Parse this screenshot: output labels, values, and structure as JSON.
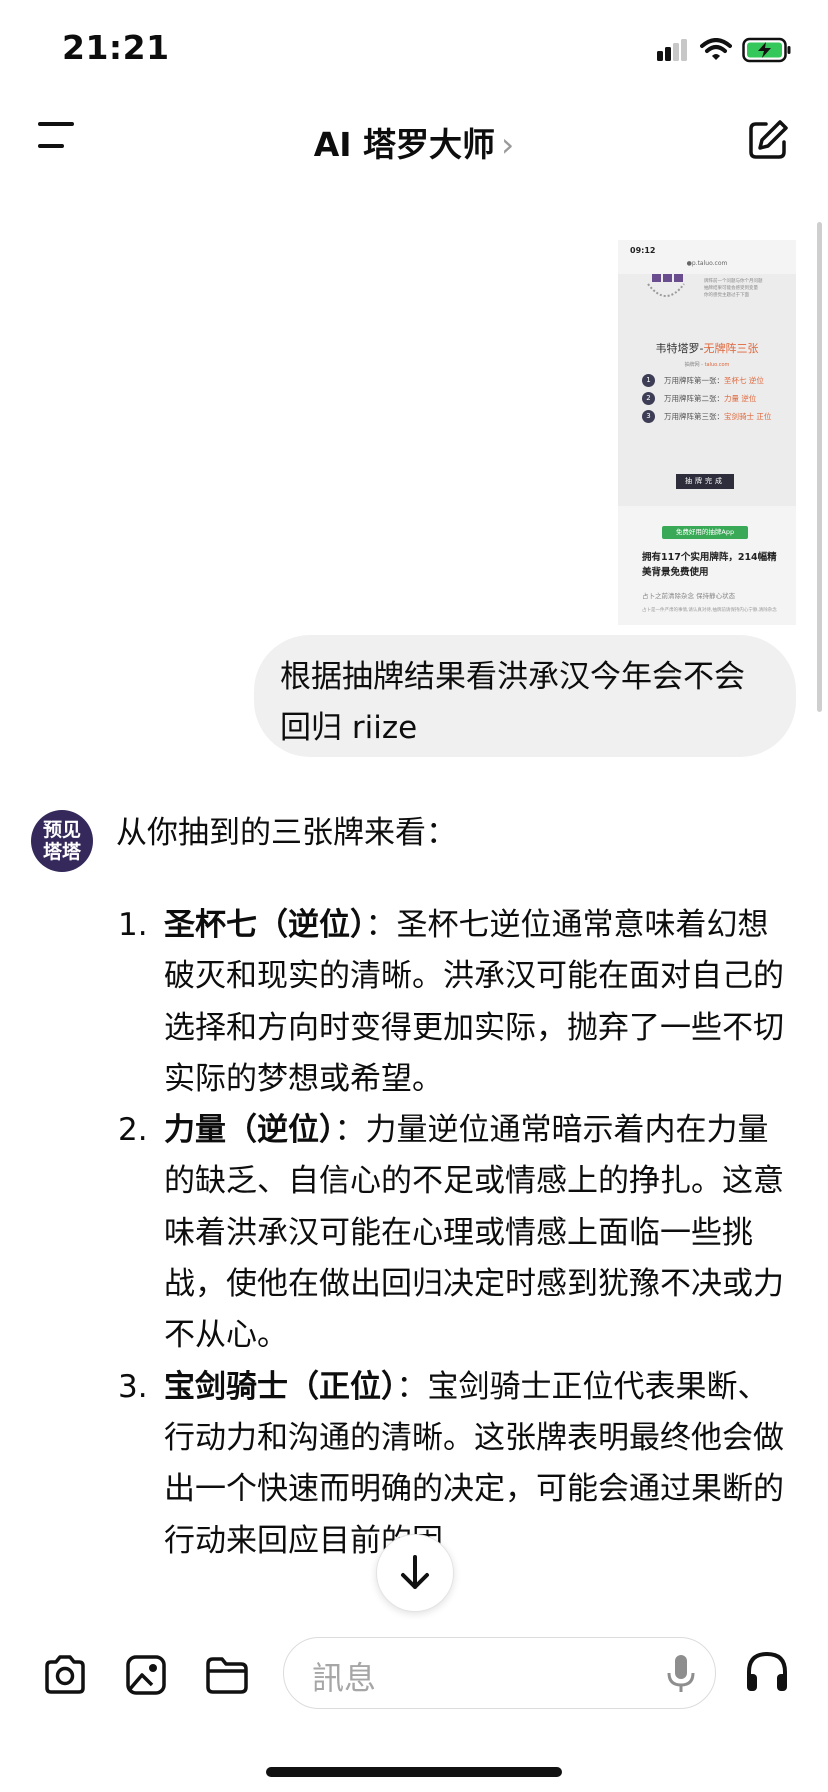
{
  "status_bar": {
    "time": "21:21",
    "icons": [
      "cellular-signal-icon",
      "wifi-icon",
      "battery-charging-icon"
    ]
  },
  "header": {
    "title": "AI 塔罗大师",
    "chevron": "›",
    "menu_icon": "menu-icon",
    "edit_icon": "new-chat-icon"
  },
  "attachment": {
    "status_time": "09:12",
    "url": "●p.taluo.com",
    "notice_lines": [
      "牌阵前一个问题与你个月问题",
      "抽牌结果可能会感受到变量",
      "你的感觉主题过于下面"
    ],
    "title_prefix": "韦特塔罗-",
    "title_highlight": "无牌阵三张",
    "source_prefix": "抽牌网 - ",
    "source_highlight": "taluo.com",
    "cards": [
      {
        "num": "1",
        "text": "万用牌阵第一张：",
        "result": "圣杯七 逆位"
      },
      {
        "num": "2",
        "text": "万用牌阵第二张：",
        "result": "力量 逆位"
      },
      {
        "num": "3",
        "text": "万用牌阵第三张：",
        "result": "宝剑骑士 正位"
      }
    ],
    "done_button": "抽牌完成",
    "app_button": "免费好用的抽牌App",
    "promo": "拥有117个实用牌阵，214幅精美背景免费使用",
    "tip": "占卜之前清除杂念 保持静心状态",
    "tiny": "占卜是一件严肃的事情,请认真对待,抽牌前请保持内心宁静,清除杂念"
  },
  "user_message": {
    "text": "根据抽牌结果看洪承汉今年会不会回归 riize"
  },
  "assistant": {
    "avatar_line1": "预见",
    "avatar_line2": "塔塔",
    "intro": "从你抽到的三张牌来看：",
    "items": [
      {
        "num": "1.",
        "title": "圣杯七（逆位）",
        "text": "：圣杯七逆位通常意味着幻想破灭和现实的清晰。洪承汉可能在面对自己的选择和方向时变得更加实际，抛弃了一些不切实际的梦想或希望。"
      },
      {
        "num": "2.",
        "title": "力量（逆位）",
        "text": "：力量逆位通常暗示着内在力量的缺乏、自信心的不足或情感上的挣扎。这意味着洪承汉可能在心理或情感上面临一些挑战，使他在做出回归决定时感到犹豫不决或力不从心。"
      },
      {
        "num": "3.",
        "title": "宝剑骑士（正位）",
        "text": "：宝剑骑士正位代表果断、行动力和沟通的清晰。这张牌表明最终他会做出一个快速而明确的决定，可能会通过果断的行动来回应目前的困"
      }
    ]
  },
  "composer": {
    "tools": [
      "camera-icon",
      "photo-icon",
      "folder-icon"
    ],
    "placeholder": "訊息",
    "mic_icon": "microphone-icon",
    "voice_icon": "headphones-icon"
  },
  "colors": {
    "accent_orange": "#e0663a",
    "avatar_bg": "#34295a",
    "bubble_bg": "#f0f0f0",
    "battery_green": "#34c759"
  }
}
